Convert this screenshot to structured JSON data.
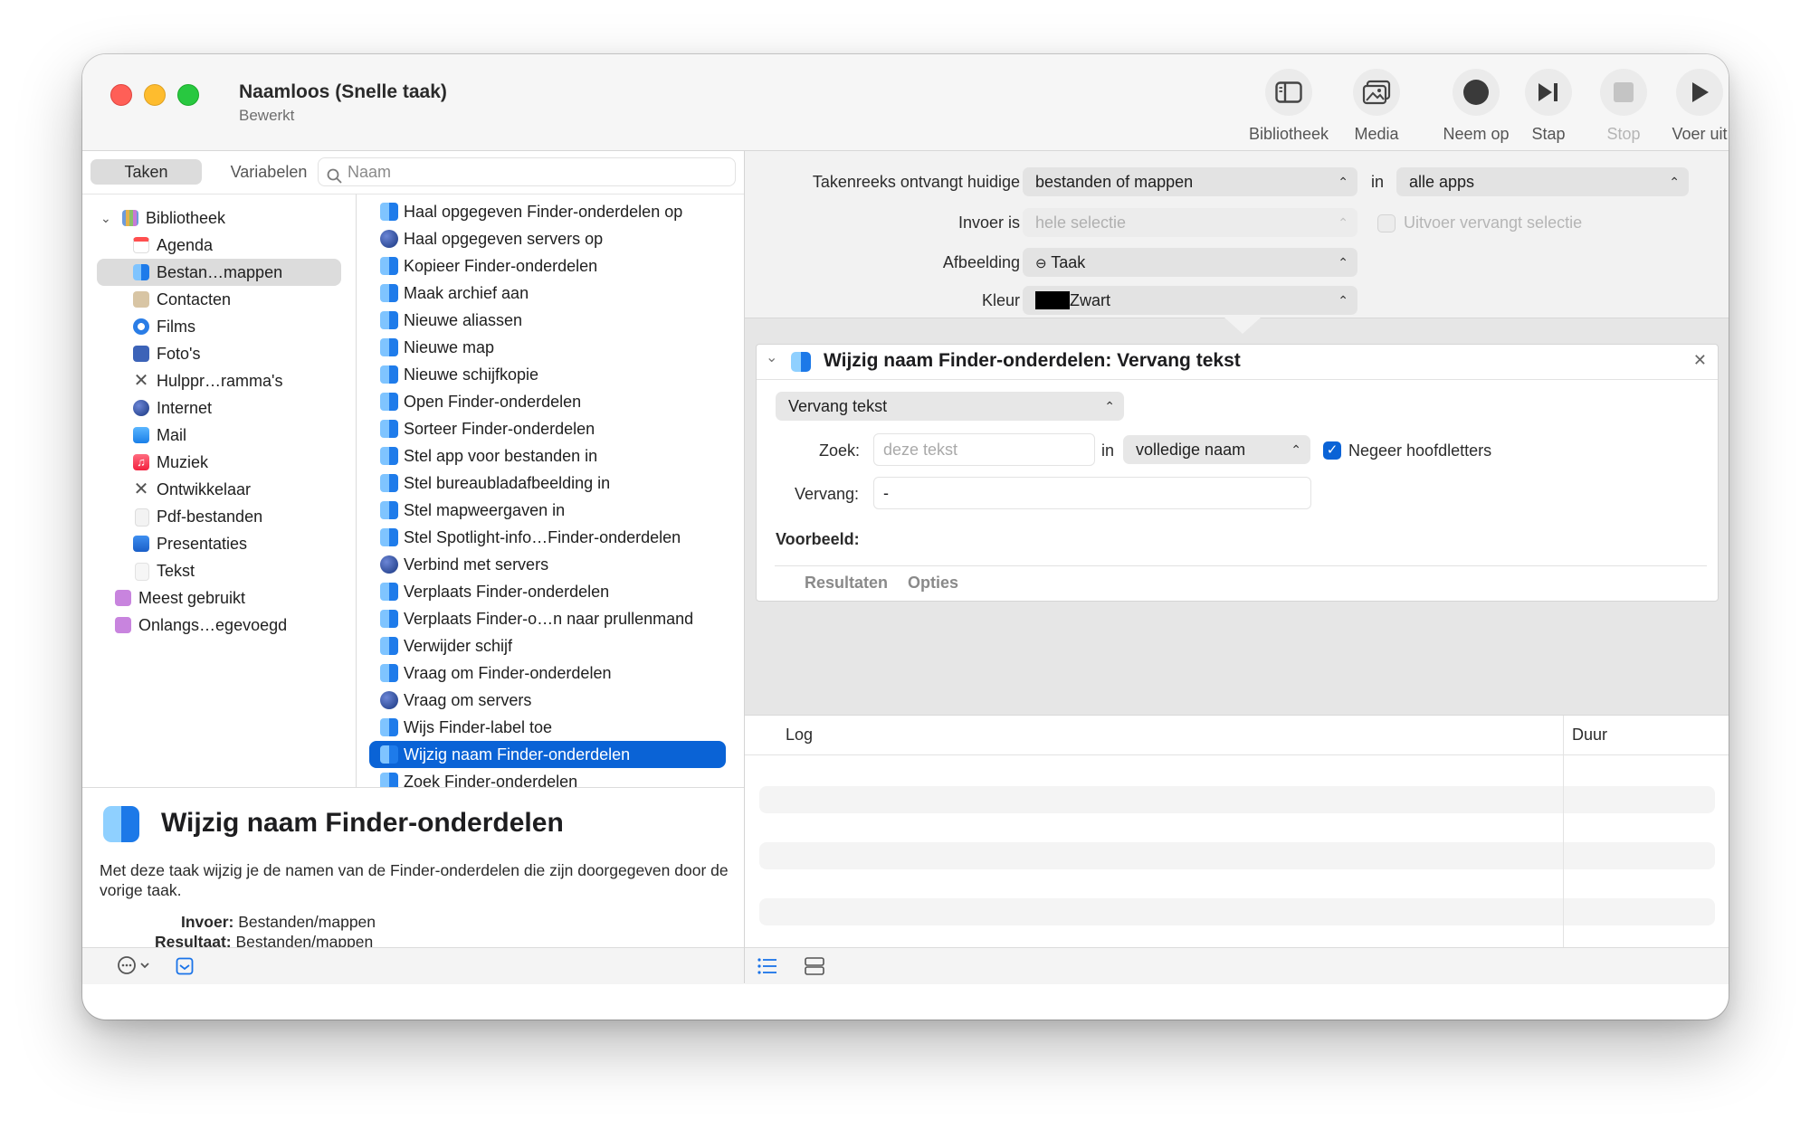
{
  "window": {
    "title": "Naamloos (Snelle taak)",
    "subtitle": "Bewerkt"
  },
  "toolbar": {
    "library": "Bibliotheek",
    "media": "Media",
    "record": "Neem op",
    "step": "Stap",
    "stop": "Stop",
    "run": "Voer uit"
  },
  "left": {
    "tabs": {
      "actions": "Taken",
      "variables": "Variabelen"
    },
    "search_placeholder": "Naam",
    "library": {
      "root": "Bibliotheek",
      "items": [
        "Agenda",
        "Bestan…mappen",
        "Contacten",
        "Films",
        "Foto's",
        "Hulppr…ramma's",
        "Internet",
        "Mail",
        "Muziek",
        "Ontwikkelaar",
        "Pdf-bestanden",
        "Presentaties",
        "Tekst"
      ],
      "smart": [
        "Meest gebruikt",
        "Onlangs…egevoegd"
      ]
    },
    "actions": [
      "Haal opgegeven Finder-onderdelen op",
      "Haal opgegeven servers op",
      "Kopieer Finder-onderdelen",
      "Maak archief aan",
      "Nieuwe aliassen",
      "Nieuwe map",
      "Nieuwe schijfkopie",
      "Open Finder-onderdelen",
      "Sorteer Finder-onderdelen",
      "Stel app voor bestanden in",
      "Stel bureaubladafbeelding in",
      "Stel mapweergaven in",
      "Stel Spotlight-info…Finder-onderdelen",
      "Verbind met servers",
      "Verplaats Finder-onderdelen",
      "Verplaats Finder-o…n naar prullenmand",
      "Verwijder schijf",
      "Vraag om Finder-onderdelen",
      "Vraag om servers",
      "Wijs Finder-label toe",
      "Wijzig naam Finder-onderdelen",
      "Zoek Finder-onderdelen"
    ],
    "description": {
      "title": "Wijzig naam Finder-onderdelen",
      "text": "Met deze taak wijzig je de namen van de Finder-onderdelen die zijn doorgegeven door de vorige taak.",
      "input_label": "Invoer:",
      "input_value": "Bestanden/mappen",
      "result_label": "Resultaat:",
      "result_value": "Bestanden/mappen"
    }
  },
  "workflow": {
    "receives_label": "Takenreeks ontvangt huidige",
    "receives_value": "bestanden of mappen",
    "in_label": "in",
    "app_value": "alle apps",
    "input_label": "Invoer is",
    "input_value": "hele selectie",
    "replaces_label": "Uitvoer vervangt selectie",
    "image_label": "Afbeelding",
    "image_value": "Taak",
    "color_label": "Kleur",
    "color_value": "Zwart"
  },
  "action_card": {
    "title": "Wijzig naam Finder-onderdelen: Vervang tekst",
    "mode": "Vervang tekst",
    "find_label": "Zoek:",
    "find_placeholder": "deze tekst",
    "in_label": "in",
    "scope": "volledige naam",
    "ignore_case": "Negeer hoofdletters",
    "replace_label": "Vervang:",
    "replace_value": "-",
    "example_label": "Voorbeeld:",
    "tab_results": "Resultaten",
    "tab_options": "Opties"
  },
  "log": {
    "col_log": "Log",
    "col_duration": "Duur"
  }
}
